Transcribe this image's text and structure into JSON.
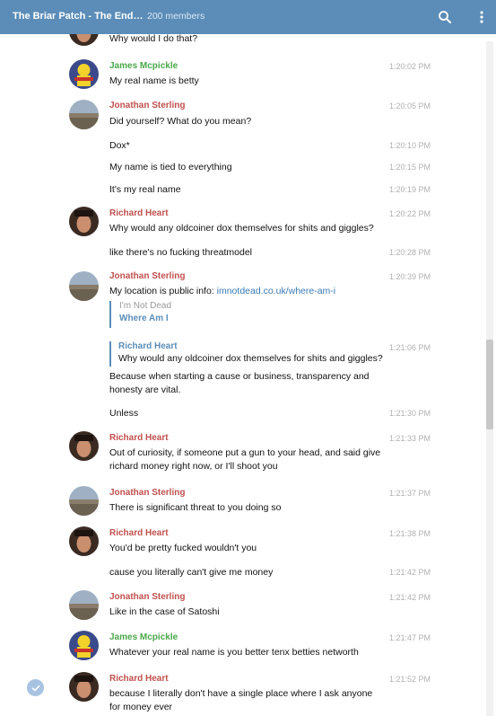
{
  "header": {
    "title": "The Briar Patch - The Ends…",
    "members": "200 members"
  },
  "messages": [
    {
      "text": "Why would I do that?"
    },
    {
      "name": "James Mcpickle",
      "time": "1:20:02 PM",
      "text": "My real name is betty"
    },
    {
      "name": "Jonathan Sterling",
      "time": "1:20:05 PM",
      "text": "Did yourself? What do you mean?"
    },
    {
      "time": "1:20:10 PM",
      "text": "Dox*"
    },
    {
      "time": "1:20:15 PM",
      "text": "My name is tied to everything"
    },
    {
      "time": "1:20:19 PM",
      "text": "It's my real name"
    },
    {
      "name": "Richard Heart",
      "time": "1:20:22 PM",
      "text": "Why would any oldcoiner dox themselves for shits and giggles?"
    },
    {
      "time": "1:20:28 PM",
      "text": "like there's no fucking threatmodel"
    },
    {
      "name": "Jonathan Sterling",
      "time": "1:20:39 PM",
      "text": "My location is public info: ",
      "link": "imnotdead.co.uk/where-am-i",
      "preview_site": "I'm Not Dead",
      "preview_title": "Where Am I"
    },
    {
      "time": "1:21:06 PM",
      "reply_name": "Richard Heart",
      "reply_text": "Why would any oldcoiner dox themselves for shits and giggles?",
      "text": "Because when starting a cause or business, transparency and honesty are vital."
    },
    {
      "time": "1:21:30 PM",
      "text": "Unless"
    },
    {
      "name": "Richard Heart",
      "time": "1:21:33 PM",
      "text": "Out of curiosity, if someone put a gun to your head, and said give richard money right now, or I'll shoot you"
    },
    {
      "name": "Jonathan Sterling",
      "time": "1:21:37 PM",
      "text": "There is significant threat to you doing so"
    },
    {
      "name": "Richard Heart",
      "time": "1:21:38 PM",
      "text": "You'd be pretty fucked wouldn't you"
    },
    {
      "time": "1:21:42 PM",
      "text": "cause you literally can't give me money"
    },
    {
      "name": "Jonathan Sterling",
      "time": "1:21:42 PM",
      "text": "Like in the case of Satoshi"
    },
    {
      "name": "James Mcpickle",
      "time": "1:21:47 PM",
      "text": "Whatever your real name is you better tenx betties networth"
    },
    {
      "name": "Richard Heart",
      "time": "1:21:52 PM",
      "text": "because I literally don't have a single place where I ask anyone for money ever"
    }
  ]
}
